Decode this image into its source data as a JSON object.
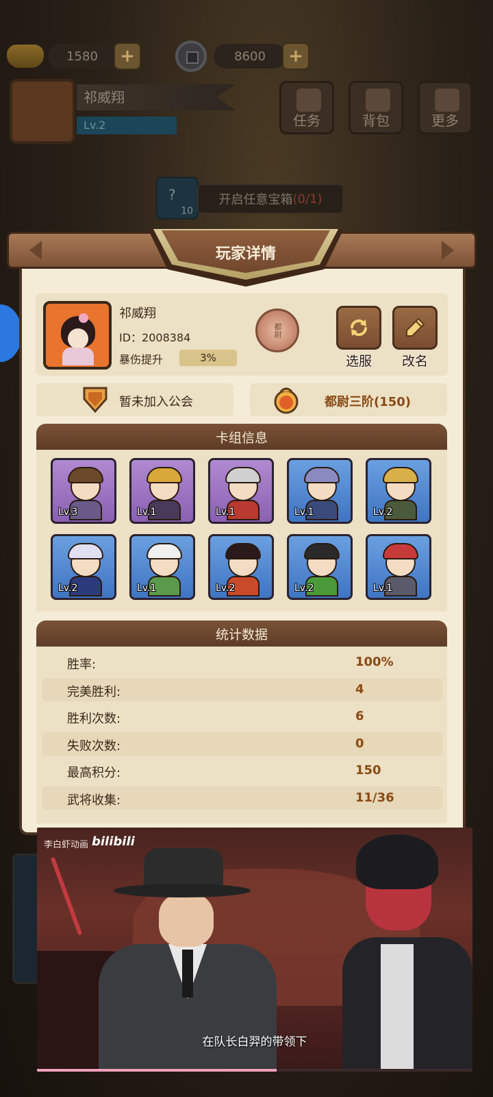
{
  "topbar": {
    "ingots": "1580",
    "coins": "8600"
  },
  "player_bg": {
    "name": "祁威翔",
    "level": "Lv.2"
  },
  "menu": {
    "tasks": "任务",
    "bag": "背包",
    "more": "更多"
  },
  "chest_banner": {
    "card_count": "10",
    "label": "开启任意宝箱",
    "progress": "(0/1)"
  },
  "modal": {
    "title": "玩家详情"
  },
  "profile": {
    "name": "祁威翔",
    "id": "ID：2008384",
    "crit_label": "暴伤提升",
    "crit_value": "3%",
    "rank_emblem_text": "都尉",
    "select_server": "选服",
    "rename": "改名"
  },
  "guild": {
    "label": "暂未加入公会"
  },
  "rank_title": {
    "label": "都尉三阶(150)"
  },
  "deck": {
    "title": "卡组信息",
    "cards": [
      {
        "level": "Lv.3",
        "rarity": "purple",
        "helm": "#6a4a2a",
        "torso": "#6a5a8a"
      },
      {
        "level": "Lv.1",
        "rarity": "purple",
        "helm": "#d8a83a",
        "torso": "#4a3a5a"
      },
      {
        "level": "Lv.1",
        "rarity": "purple",
        "helm": "#d0d0d0",
        "torso": "#b83a30"
      },
      {
        "level": "Lv.1",
        "rarity": "blue",
        "helm": "#8a8ac0",
        "torso": "#3a4a7a"
      },
      {
        "level": "Lv.2",
        "rarity": "blue",
        "helm": "#d8b04a",
        "torso": "#4a5a3a"
      },
      {
        "level": "Lv.2",
        "rarity": "blue",
        "helm": "#e0e0f0",
        "torso": "#2a3a7a"
      },
      {
        "level": "Lv.1",
        "rarity": "blue",
        "helm": "#f0f0f0",
        "torso": "#5a9a4a"
      },
      {
        "level": "Lv.2",
        "rarity": "blue",
        "helm": "#2a1a1a",
        "torso": "#c84a2a"
      },
      {
        "level": "Lv.2",
        "rarity": "blue",
        "helm": "#2a2a2a",
        "torso": "#4a9a3a"
      },
      {
        "level": "Lv.1",
        "rarity": "blue",
        "helm": "#c83a3a",
        "torso": "#5a5a6a"
      }
    ]
  },
  "stats": {
    "title": "统计数据",
    "rows": [
      {
        "label": "胜率:",
        "value": "100%"
      },
      {
        "label": "完美胜利:",
        "value": "4"
      },
      {
        "label": "胜利次数:",
        "value": "6"
      },
      {
        "label": "失败次数:",
        "value": "0"
      },
      {
        "label": "最高积分:",
        "value": "150"
      },
      {
        "label": "武将收集:",
        "value": "11/36"
      }
    ]
  },
  "video": {
    "watermark": "李白虾动画",
    "logo": "bilibili",
    "subtitle": "在队长白羿的带领下",
    "progress": 0.55
  }
}
